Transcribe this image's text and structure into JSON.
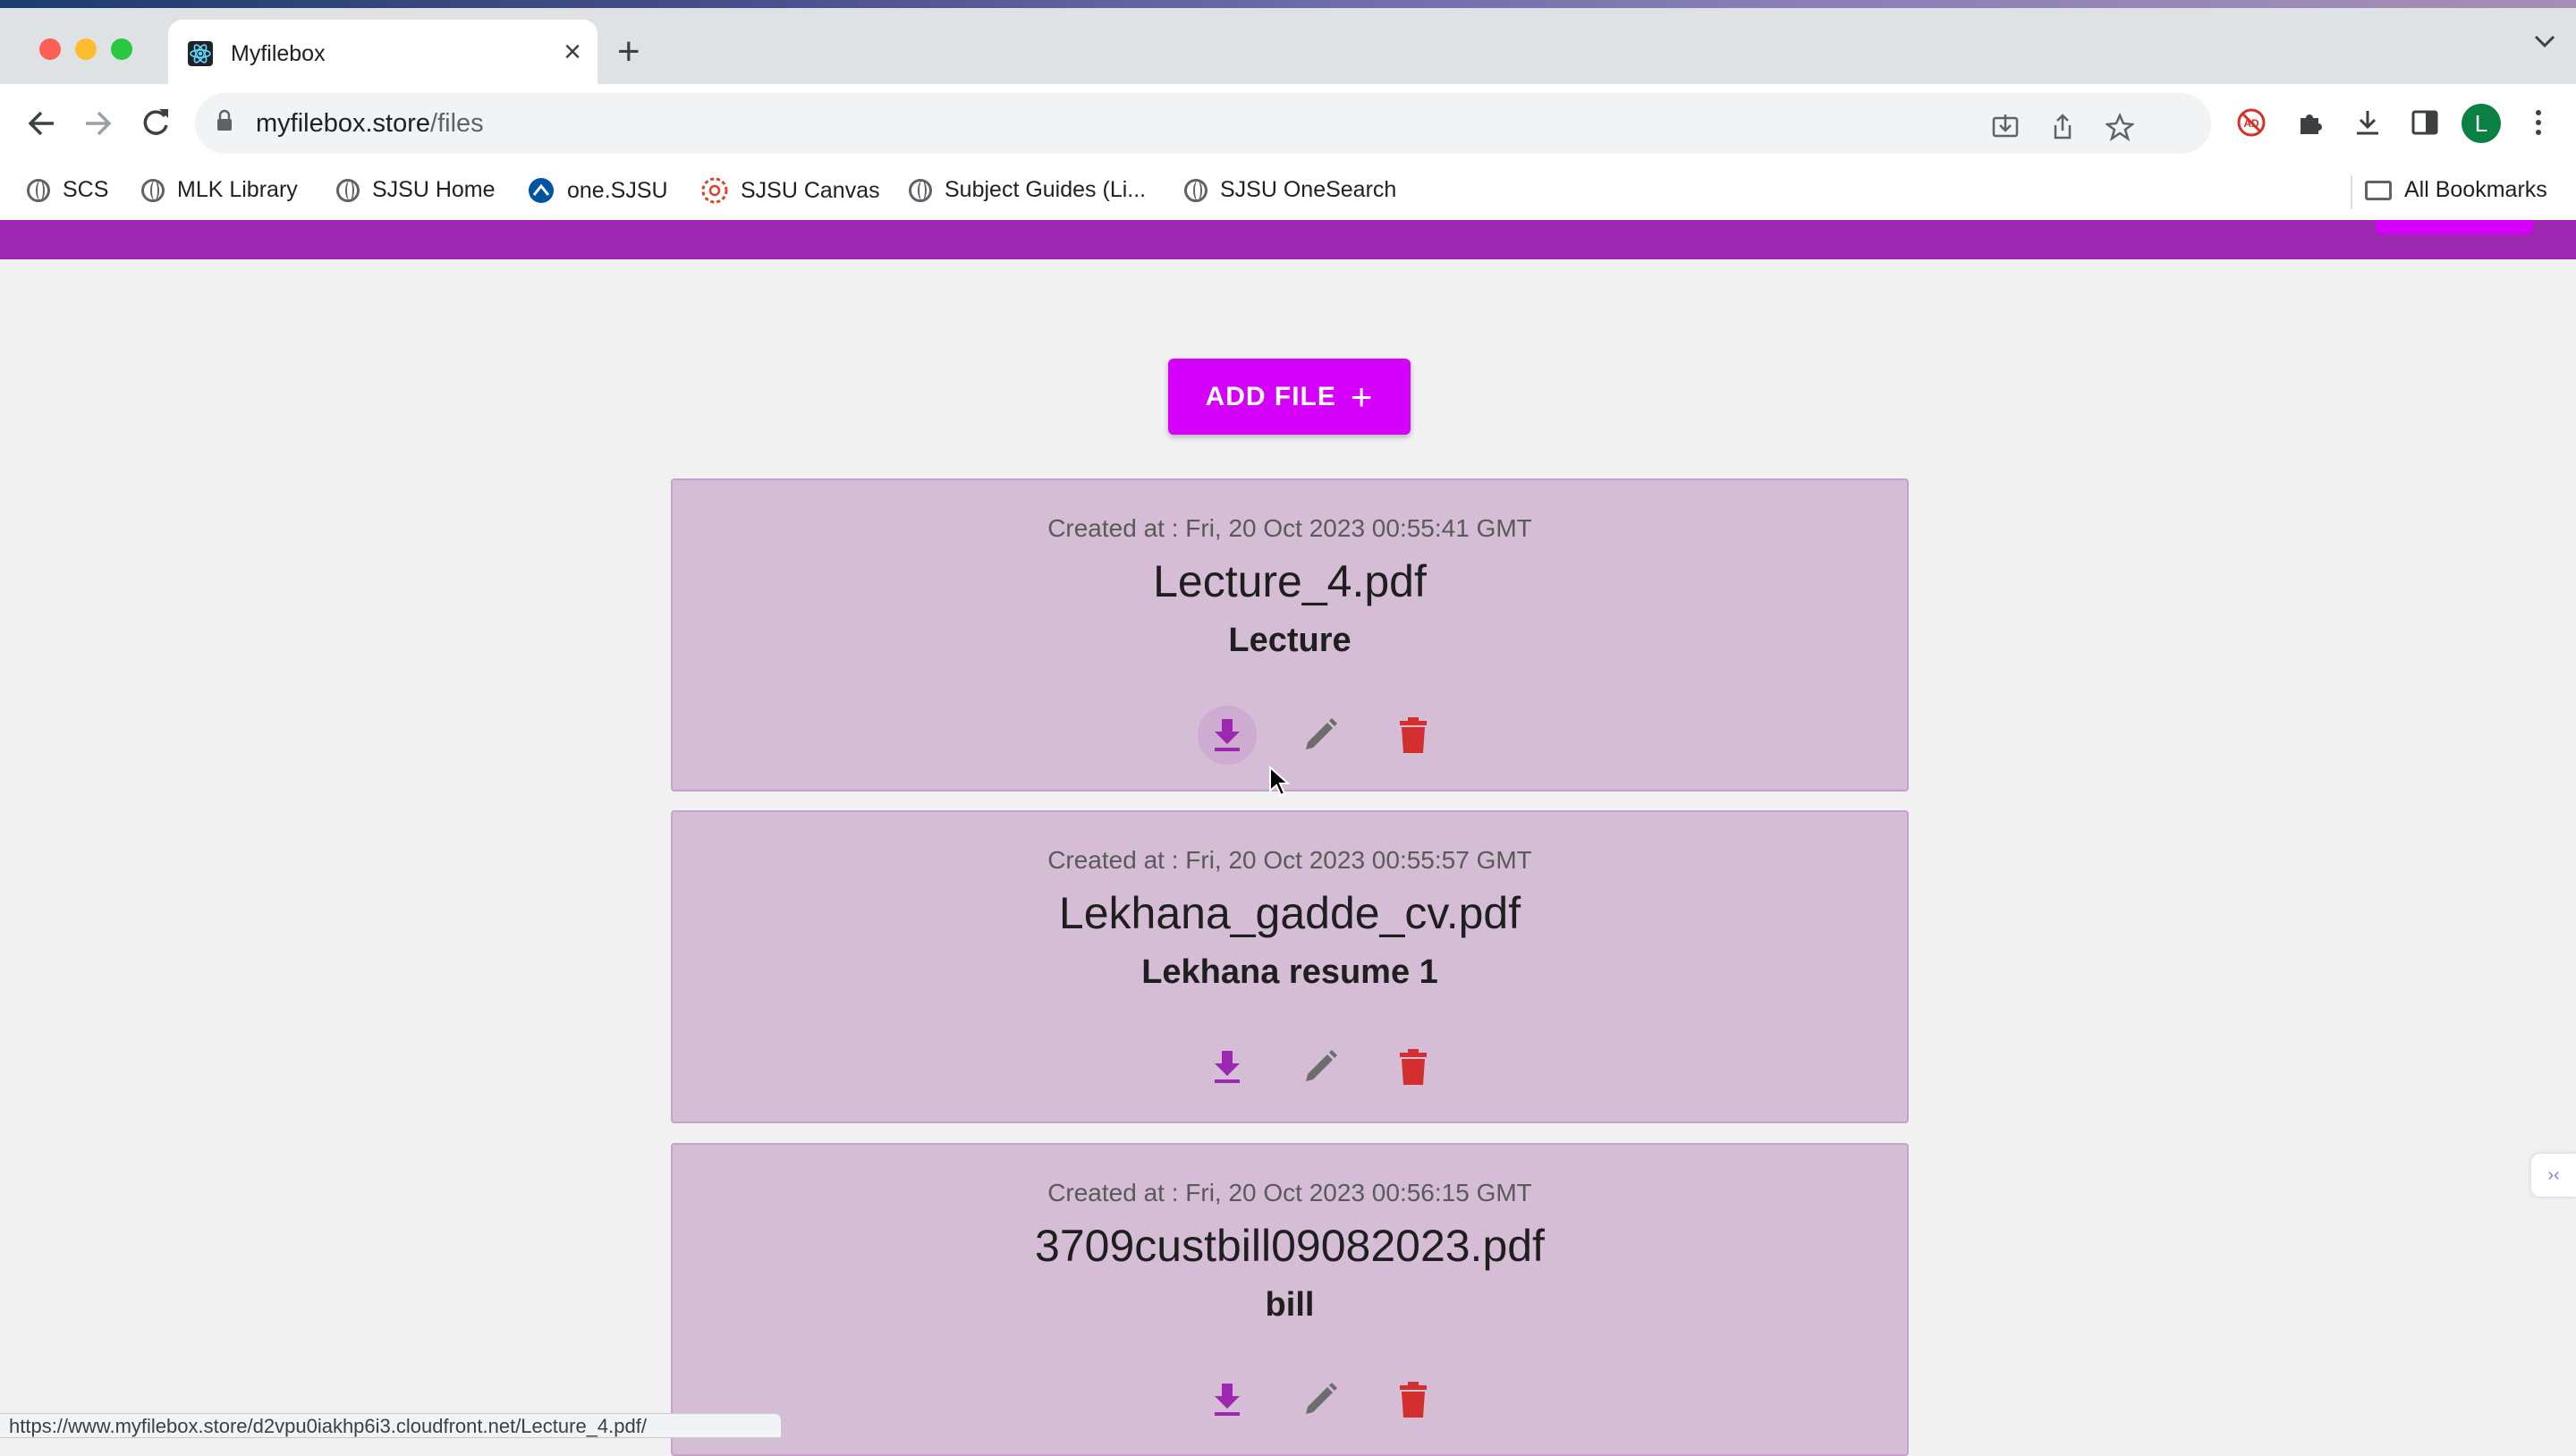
{
  "browser": {
    "tab_title": "Myfilebox",
    "url_domain": "myfilebox.store",
    "url_path": "/files",
    "avatar_letter": "L",
    "bookmarks": [
      {
        "label": "SCS"
      },
      {
        "label": "MLK Library"
      },
      {
        "label": "SJSU Home"
      },
      {
        "label": "one.SJSU"
      },
      {
        "label": "SJSU Canvas"
      },
      {
        "label": "Subject Guides (Li..."
      },
      {
        "label": "SJSU OneSearch"
      }
    ],
    "all_bookmarks_label": "All Bookmarks",
    "status_url": "https://www.myfilebox.store/d2vpu0iakhp6i3.cloudfront.net/Lecture_4.pdf/"
  },
  "page": {
    "add_file_label": "ADD FILE",
    "accent_color": "#d500f9",
    "appbar_color": "#9c27b0",
    "files": [
      {
        "created": "Created at : Fri, 20 Oct 2023 00:55:41 GMT",
        "name": "Lecture_4.pdf",
        "description": "Lecture"
      },
      {
        "created": "Created at : Fri, 20 Oct 2023 00:55:57 GMT",
        "name": "Lekhana_gadde_cv.pdf",
        "description": "Lekhana resume 1"
      },
      {
        "created": "Created at : Fri, 20 Oct 2023 00:56:15 GMT",
        "name": "3709custbill09082023.pdf",
        "description": "bill"
      }
    ]
  }
}
